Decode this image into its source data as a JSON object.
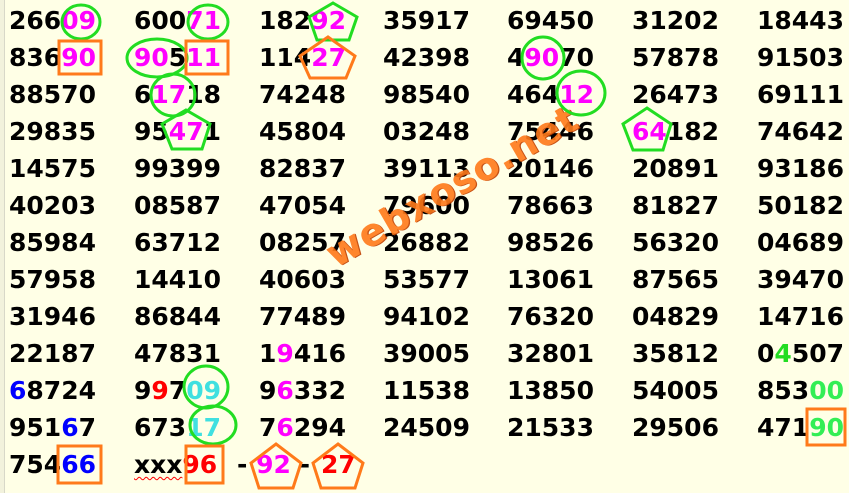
{
  "rows": [
    [
      [
        [
          "266",
          ""
        ],
        [
          "09",
          "magenta"
        ]
      ],
      [
        [
          "600",
          ""
        ],
        [
          "71",
          "magenta"
        ]
      ],
      [
        [
          "182",
          ""
        ],
        [
          "92",
          "magenta"
        ]
      ],
      [
        [
          "35917",
          ""
        ]
      ],
      [
        [
          "69450",
          ""
        ]
      ],
      [
        [
          "31202",
          ""
        ]
      ],
      [
        [
          "18443",
          ""
        ]
      ]
    ],
    [
      [
        [
          "836",
          ""
        ],
        [
          "90",
          "magenta"
        ]
      ],
      [
        [
          "90",
          "magenta"
        ],
        [
          "5",
          ""
        ],
        [
          "11",
          "magenta"
        ]
      ],
      [
        [
          "114",
          ""
        ],
        [
          "27",
          "magenta"
        ]
      ],
      [
        [
          "42398",
          ""
        ]
      ],
      [
        [
          "4",
          ""
        ],
        [
          "90",
          "magenta"
        ],
        [
          "70",
          ""
        ]
      ],
      [
        [
          "57878",
          ""
        ]
      ],
      [
        [
          "91503",
          ""
        ]
      ]
    ],
    [
      [
        [
          "88570",
          ""
        ]
      ],
      [
        [
          "6",
          ""
        ],
        [
          "17",
          "magenta"
        ],
        [
          "18",
          ""
        ]
      ],
      [
        [
          "74248",
          ""
        ]
      ],
      [
        [
          "98540",
          ""
        ]
      ],
      [
        [
          "464",
          ""
        ],
        [
          "12",
          "magenta"
        ]
      ],
      [
        [
          "26473",
          ""
        ]
      ],
      [
        [
          "69111",
          ""
        ]
      ]
    ],
    [
      [
        [
          "29835",
          ""
        ]
      ],
      [
        [
          "95",
          ""
        ],
        [
          "47",
          "magenta"
        ],
        [
          "1",
          ""
        ]
      ],
      [
        [
          "45804",
          ""
        ]
      ],
      [
        [
          "03248",
          ""
        ]
      ],
      [
        [
          "75446",
          ""
        ]
      ],
      [
        [
          "",
          ""
        ],
        [
          "64",
          "magenta"
        ],
        [
          "182",
          ""
        ]
      ],
      [
        [
          "74642",
          ""
        ]
      ]
    ],
    [
      [
        [
          "14575",
          ""
        ]
      ],
      [
        [
          "99399",
          ""
        ]
      ],
      [
        [
          "82837",
          ""
        ]
      ],
      [
        [
          "39113",
          ""
        ]
      ],
      [
        [
          "20146",
          ""
        ]
      ],
      [
        [
          "20891",
          ""
        ]
      ],
      [
        [
          "93186",
          ""
        ]
      ]
    ],
    [
      [
        [
          "40203",
          ""
        ]
      ],
      [
        [
          "08587",
          ""
        ]
      ],
      [
        [
          "47054",
          ""
        ]
      ],
      [
        [
          "79600",
          ""
        ]
      ],
      [
        [
          "78663",
          ""
        ]
      ],
      [
        [
          "81827",
          ""
        ]
      ],
      [
        [
          "50182",
          ""
        ]
      ]
    ],
    [
      [
        [
          "85984",
          ""
        ]
      ],
      [
        [
          "63712",
          ""
        ]
      ],
      [
        [
          "08257",
          ""
        ]
      ],
      [
        [
          "26882",
          ""
        ]
      ],
      [
        [
          "98526",
          ""
        ]
      ],
      [
        [
          "56320",
          ""
        ]
      ],
      [
        [
          "04689",
          ""
        ]
      ]
    ],
    [
      [
        [
          "57958",
          ""
        ]
      ],
      [
        [
          "14410",
          ""
        ]
      ],
      [
        [
          "40603",
          ""
        ]
      ],
      [
        [
          "53577",
          ""
        ]
      ],
      [
        [
          "13061",
          ""
        ]
      ],
      [
        [
          "87565",
          ""
        ]
      ],
      [
        [
          "39470",
          ""
        ]
      ]
    ],
    [
      [
        [
          "31946",
          ""
        ]
      ],
      [
        [
          "86844",
          ""
        ]
      ],
      [
        [
          "77489",
          ""
        ]
      ],
      [
        [
          "94102",
          ""
        ]
      ],
      [
        [
          "76320",
          ""
        ]
      ],
      [
        [
          "04829",
          ""
        ]
      ],
      [
        [
          "14716",
          ""
        ]
      ]
    ],
    [
      [
        [
          "22187",
          ""
        ]
      ],
      [
        [
          "47831",
          ""
        ]
      ],
      [
        [
          "1",
          ""
        ],
        [
          "9",
          "magenta"
        ],
        [
          "416",
          ""
        ]
      ],
      [
        [
          "39005",
          ""
        ]
      ],
      [
        [
          "32801",
          ""
        ]
      ],
      [
        [
          "35812",
          ""
        ]
      ],
      [
        [
          "0",
          ""
        ],
        [
          "4",
          "green"
        ],
        [
          "507",
          ""
        ]
      ]
    ],
    [
      [
        [
          "6",
          "blue"
        ],
        [
          "8724",
          ""
        ]
      ],
      [
        [
          "9",
          ""
        ],
        [
          "9",
          "red"
        ],
        [
          "7",
          ""
        ],
        [
          "09",
          "cyan"
        ]
      ],
      [
        [
          "9",
          ""
        ],
        [
          "6",
          "magenta"
        ],
        [
          "332",
          ""
        ]
      ],
      [
        [
          "11538",
          ""
        ]
      ],
      [
        [
          "13850",
          ""
        ]
      ],
      [
        [
          "54005",
          ""
        ]
      ],
      [
        [
          "853",
          ""
        ],
        [
          "00",
          "lime"
        ]
      ]
    ],
    [
      [
        [
          "951",
          ""
        ],
        [
          "6",
          "blue"
        ],
        [
          "7",
          ""
        ]
      ],
      [
        [
          "673",
          ""
        ],
        [
          "17",
          "cyan"
        ]
      ],
      [
        [
          "7",
          ""
        ],
        [
          "6",
          "magenta"
        ],
        [
          "294",
          ""
        ]
      ],
      [
        [
          "24509",
          ""
        ]
      ],
      [
        [
          "21533",
          ""
        ]
      ],
      [
        [
          "29506",
          ""
        ]
      ],
      [
        [
          "471",
          ""
        ],
        [
          "90",
          "lime"
        ]
      ]
    ],
    [
      [
        [
          "754",
          ""
        ],
        [
          "66",
          "blue"
        ]
      ],
      [
        [
          "xxx",
          ""
        ],
        [
          "96",
          "red"
        ]
      ],
      [
        [
          "- ",
          ""
        ],
        [
          "92",
          "magenta"
        ],
        [
          " -",
          ""
        ]
      ],
      [
        [
          "27",
          "red"
        ]
      ],
      [],
      [],
      []
    ]
  ],
  "watermark": "webxoso.net",
  "colors": {
    "magenta": "#ff00ff",
    "red": "#ff0000",
    "blue": "#0000ff",
    "cyan": "#40e0e0",
    "green": "#22dd22",
    "lime": "#33ee55",
    "marker_green": "#22dd22",
    "marker_orange": "#ff7a1a"
  }
}
